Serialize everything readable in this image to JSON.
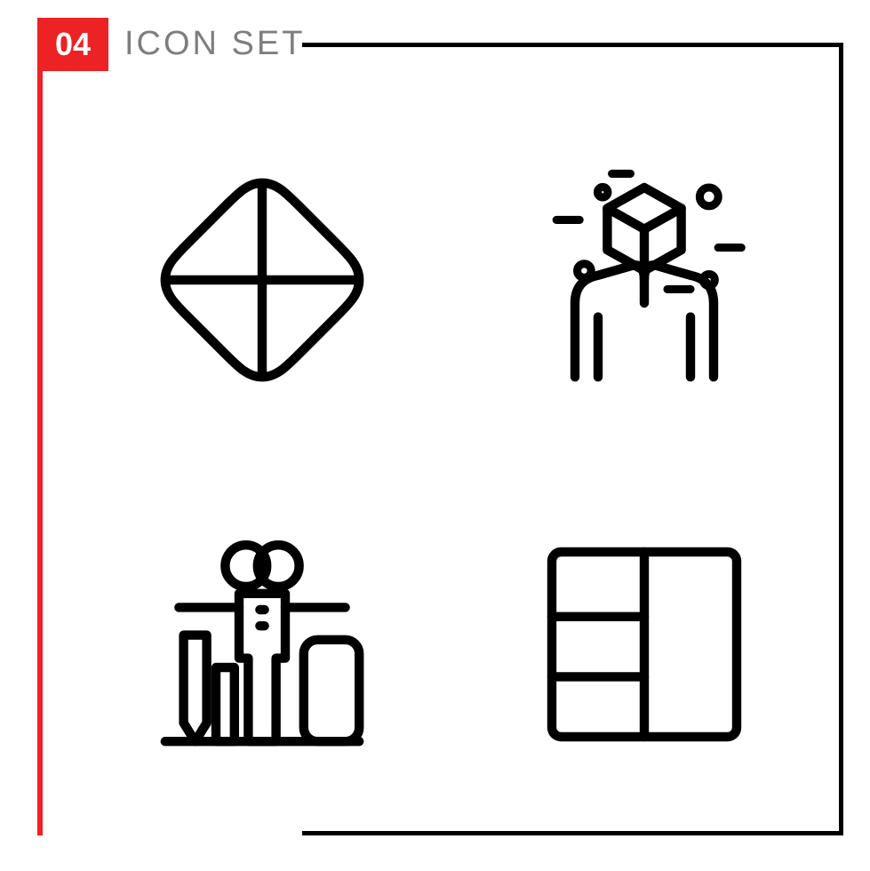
{
  "header": {
    "badge_number": "04",
    "title": "ICON SET"
  },
  "colors": {
    "accent": "#ed2224",
    "frame": "#000000",
    "title_text": "#7e7e7e"
  },
  "icons": [
    {
      "name": "diamond-cross-icon",
      "semantic": "sign / diamond with cross"
    },
    {
      "name": "hands-box-icon",
      "semantic": "hands holding cube / care package"
    },
    {
      "name": "person-balance-icon",
      "semantic": "person with spread arms, pencil, phone"
    },
    {
      "name": "layout-grid-icon",
      "semantic": "layout / grid cells"
    }
  ]
}
